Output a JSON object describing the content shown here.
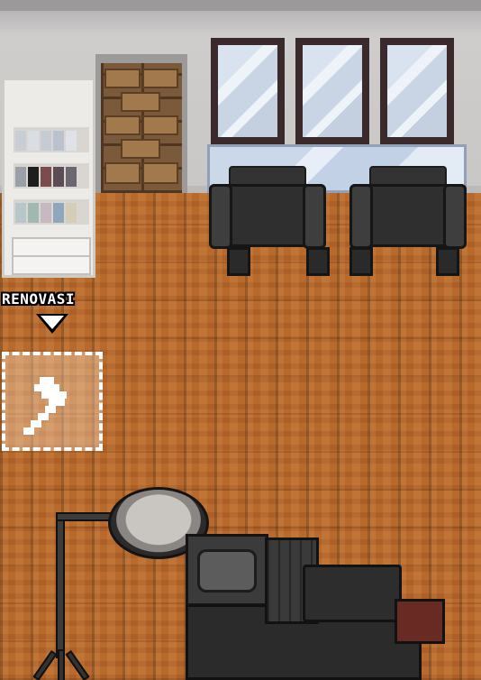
{
  "scene": {
    "renovate": {
      "label": "RENOVASI",
      "icon": "hammer-icon"
    }
  },
  "colors": {
    "floor": "#b8692c",
    "wall": "#c9c7c6",
    "chair": "#2f2f2f",
    "hint_text": "#ffffff"
  }
}
